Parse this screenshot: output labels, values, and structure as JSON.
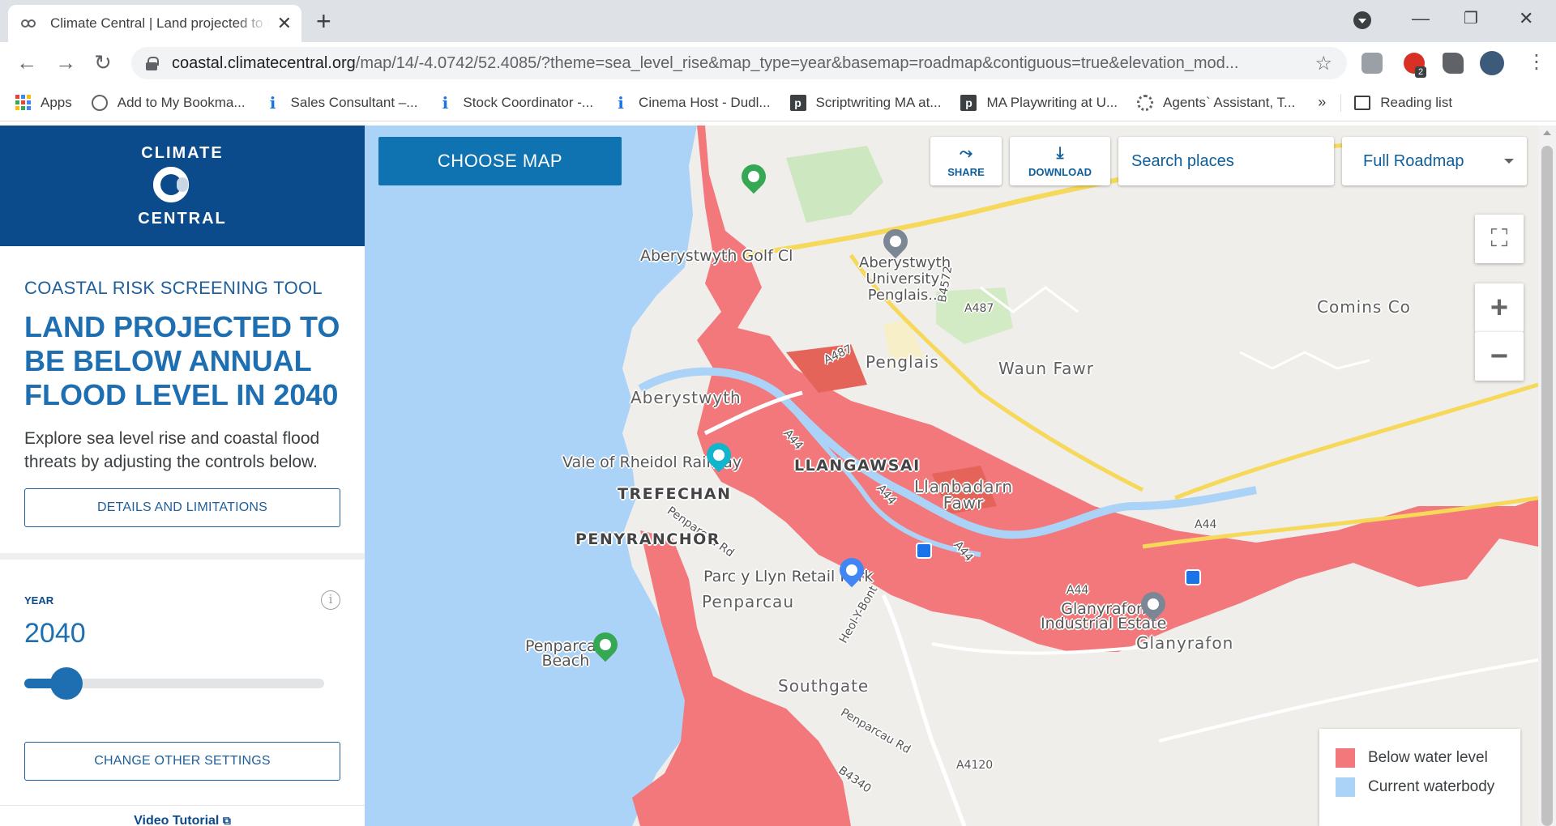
{
  "browser": {
    "tab_title": "Climate Central | Land projected to be below annual flood level",
    "tab_close": "✕",
    "new_tab": "+",
    "url_host": "coastal.climatecentral.org",
    "url_path": "/map/14/-4.0742/52.4085/?theme=sea_level_rise&map_type=year&basemap=roadmap&contiguous=true&elevation_mod...",
    "extension_badge": "2",
    "bookmarks": [
      {
        "label": "Apps",
        "icon": "apps-grid-icon"
      },
      {
        "label": "Add to My Bookma...",
        "icon": "globe-icon"
      },
      {
        "label": "Sales Consultant –...",
        "icon": "info-i-icon"
      },
      {
        "label": "Stock Coordinator -...",
        "icon": "info-i-icon"
      },
      {
        "label": "Cinema Host - Dudl...",
        "icon": "info-i-icon"
      },
      {
        "label": "Scriptwriting MA at...",
        "icon": "p-icon"
      },
      {
        "label": "MA Playwriting at U...",
        "icon": "p-icon"
      },
      {
        "label": "Agents` Assistant, T...",
        "icon": "ring-icon"
      }
    ],
    "bookmarks_more": "»",
    "reading_list": "Reading list"
  },
  "sidebar": {
    "brand_top": "CLIMATE",
    "brand_bottom": "CENTRAL",
    "tool_label": "COASTAL RISK SCREENING TOOL",
    "title": "LAND PROJECTED TO BE BELOW ANNUAL FLOOD LEVEL IN 2040",
    "intro": "Explore sea level rise and coastal flood threats by adjusting the controls below.",
    "details_button": "DETAILS AND LIMITATIONS",
    "year_label": "YEAR",
    "year_value": "2040",
    "year_slider_fraction": 0.14,
    "change_settings_button": "CHANGE OTHER SETTINGS",
    "video_tutorial": "Video Tutorial"
  },
  "map": {
    "choose_map": "CHOOSE MAP",
    "share": "SHARE",
    "download": "DOWNLOAD",
    "search_placeholder": "Search places",
    "basemap_value": "Full Roadmap",
    "zoom_in": "+",
    "zoom_out": "−",
    "labels": {
      "aberystwyth_golf": "Aberystwyth Golf Cl",
      "university": "Aberystwyth\nUniversity,\nPenglais...",
      "comins_coch": "Comins Co",
      "penglais": "Penglais",
      "waun_fawr": "Waun Fawr",
      "aberystwyth": "Aberystwyth",
      "vale_of_rheidol": "Vale of Rheidol Railway",
      "llangawsai": "LLANGAWSAI",
      "llanbadarn": "Llanbadarn\nFawr",
      "trefechan": "TREFECHAN",
      "penparcau_rd": "Penparcau Rd",
      "penyranchor": "PENYRANCHOR",
      "parc_y_llyn": "Parc y Llyn Retail Park",
      "penparcau": "Penparcau",
      "glanyrafon_ind": "Glanyrafon\nIndustrial Estate",
      "glanyrafon": "Glanyrafon",
      "penparcau_beach": "Penparcau\nBeach",
      "southgate": "Southgate",
      "heol_y_bont": "Heol-Y-Bont",
      "penparcau_rd2": "Penparcau Rd",
      "a487_1": "A487",
      "a487_2": "A487",
      "a44_1": "A44",
      "a44_2": "A44",
      "a44_3": "A44",
      "a44_4": "A44",
      "a44_5": "A44",
      "b4572": "B4572",
      "a4120": "A4120",
      "b4340": "B4340"
    },
    "legend": [
      {
        "label": "Below water level",
        "color": "#f3787b"
      },
      {
        "label": "Current waterbody",
        "color": "#aad3f7"
      }
    ],
    "colors": {
      "flood": "#f3787b",
      "water": "#aad3f7",
      "land": "#efeeea",
      "accent": "#0e73b0"
    }
  }
}
